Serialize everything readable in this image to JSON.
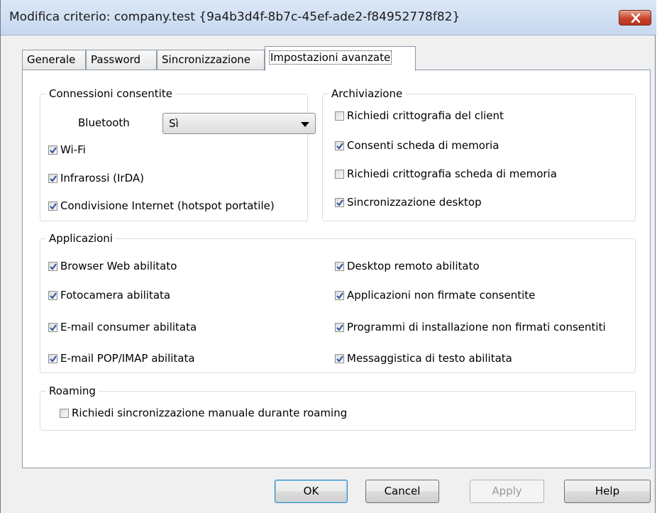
{
  "window": {
    "title": "Modifica criterio:  company.test {9a4b3d4f-8b7c-45ef-ade2-f84952778f82}"
  },
  "tabs": [
    {
      "label": "Generale",
      "active": false
    },
    {
      "label": "Password",
      "active": false
    },
    {
      "label": "Sincronizzazione",
      "active": false
    },
    {
      "label": "Impostazioni avanzate",
      "active": true
    }
  ],
  "connessioni": {
    "legend": "Connessioni consentite",
    "bluetooth_label": "Bluetooth",
    "bluetooth_value": "Sì",
    "items": [
      {
        "label": "Wi-Fi",
        "checked": true
      },
      {
        "label": "Infrarossi (IrDA)",
        "checked": true
      },
      {
        "label": "Condivisione Internet (hotspot portatile)",
        "checked": true
      }
    ]
  },
  "archiviazione": {
    "legend": "Archiviazione",
    "items": [
      {
        "label": "Richiedi crittografia del client",
        "checked": false
      },
      {
        "label": "Consenti scheda di memoria",
        "checked": true
      },
      {
        "label": "Richiedi crittografia scheda di memoria",
        "checked": false
      },
      {
        "label": "Sincronizzazione desktop",
        "checked": true
      }
    ]
  },
  "applicazioni": {
    "legend": "Applicazioni",
    "left": [
      {
        "label": "Browser Web abilitato",
        "checked": true
      },
      {
        "label": "Fotocamera abilitata",
        "checked": true
      },
      {
        "label": "E-mail consumer abilitata",
        "checked": true
      },
      {
        "label": "E-mail POP/IMAP abilitata",
        "checked": true
      }
    ],
    "right": [
      {
        "label": "Desktop remoto abilitato",
        "checked": true
      },
      {
        "label": "Applicazioni non firmate consentite",
        "checked": true
      },
      {
        "label": "Programmi di installazione non firmati consentiti",
        "checked": true
      },
      {
        "label": "Messaggistica di testo abilitata",
        "checked": true
      }
    ]
  },
  "roaming": {
    "legend": "Roaming",
    "items": [
      {
        "label": "Richiedi sincronizzazione manuale durante roaming",
        "checked": false
      }
    ]
  },
  "buttons": {
    "ok": "OK",
    "cancel": "Cancel",
    "apply": "Apply",
    "help": "Help"
  },
  "colors": {
    "checkmark": "#2b4fa0",
    "close_button": "#c9442b",
    "default_button_border": "#3c7fb1"
  }
}
